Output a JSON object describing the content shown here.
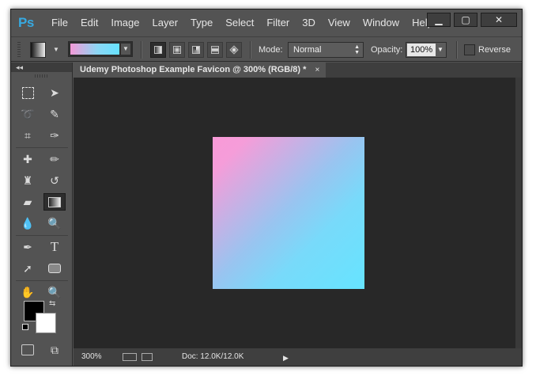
{
  "app": {
    "logo": "Ps"
  },
  "menu": [
    "File",
    "Edit",
    "Image",
    "Layer",
    "Type",
    "Select",
    "Filter",
    "3D",
    "View",
    "Window",
    "Help"
  ],
  "window_controls": {
    "minimize": "▁",
    "maximize": "▢",
    "close": "✕"
  },
  "options": {
    "gradient_colors": [
      "#f49ad8",
      "#66e2ff"
    ],
    "mode_label": "Mode:",
    "mode_value": "Normal",
    "opacity_label": "Opacity:",
    "opacity_value": "100%",
    "reverse_label": "Reverse"
  },
  "document": {
    "tab_title": "Udemy Photoshop Example Favicon @ 300% (RGB/8) *",
    "tab_close": "×",
    "gradient_start": "#f99ad8",
    "gradient_end": "#66e4ff"
  },
  "tools": {
    "collapse_label": "◂◂",
    "fg_color": "#000000",
    "bg_color": "#ffffff"
  },
  "status": {
    "zoom": "300%",
    "doc_info": "Doc: 12.0K/12.0K"
  }
}
